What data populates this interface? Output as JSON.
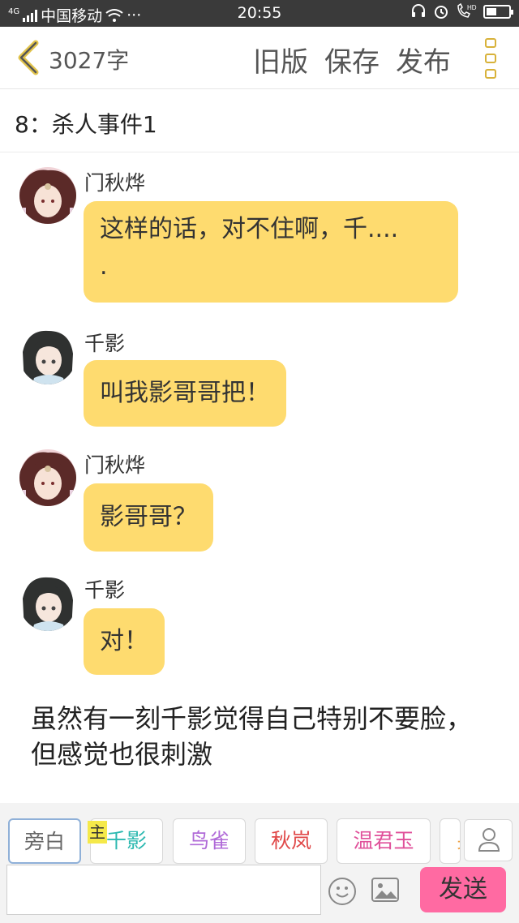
{
  "status_bar": {
    "network": "4G",
    "carrier": "中国移动",
    "more": "···",
    "time": "20:55",
    "hd": "HD"
  },
  "header": {
    "word_count": "3027字",
    "old_version": "旧版",
    "save": "保存",
    "publish": "发布"
  },
  "chapter": {
    "title": "8：杀人事件1"
  },
  "messages": [
    {
      "speaker": "门秋烨",
      "text": "这样的话，对不住啊，千....\n."
    },
    {
      "speaker": "千影",
      "text": "叫我影哥哥把！"
    },
    {
      "speaker": "门秋烨",
      "text": "影哥哥？"
    },
    {
      "speaker": "千影",
      "text": "对！"
    }
  ],
  "narration": "虽然有一刻千影觉得自己特别不要脸，但感觉也很刺激",
  "roles": {
    "main_tag": "主",
    "items": [
      {
        "label": "旁白",
        "color": "#666666"
      },
      {
        "label": "千影",
        "color": "#2bb8b0"
      },
      {
        "label": "鸟雀",
        "color": "#b06ad8"
      },
      {
        "label": "秋岚",
        "color": "#e04848"
      },
      {
        "label": "温君玉",
        "color": "#e0509a"
      },
      {
        "label": "另",
        "color": "#f0a040"
      }
    ]
  },
  "composer": {
    "input_value": "",
    "send_label": "发送"
  },
  "colors": {
    "bubble": "#fedb6f",
    "send_button": "#ff6aa2",
    "accent": "#d8b23a"
  }
}
